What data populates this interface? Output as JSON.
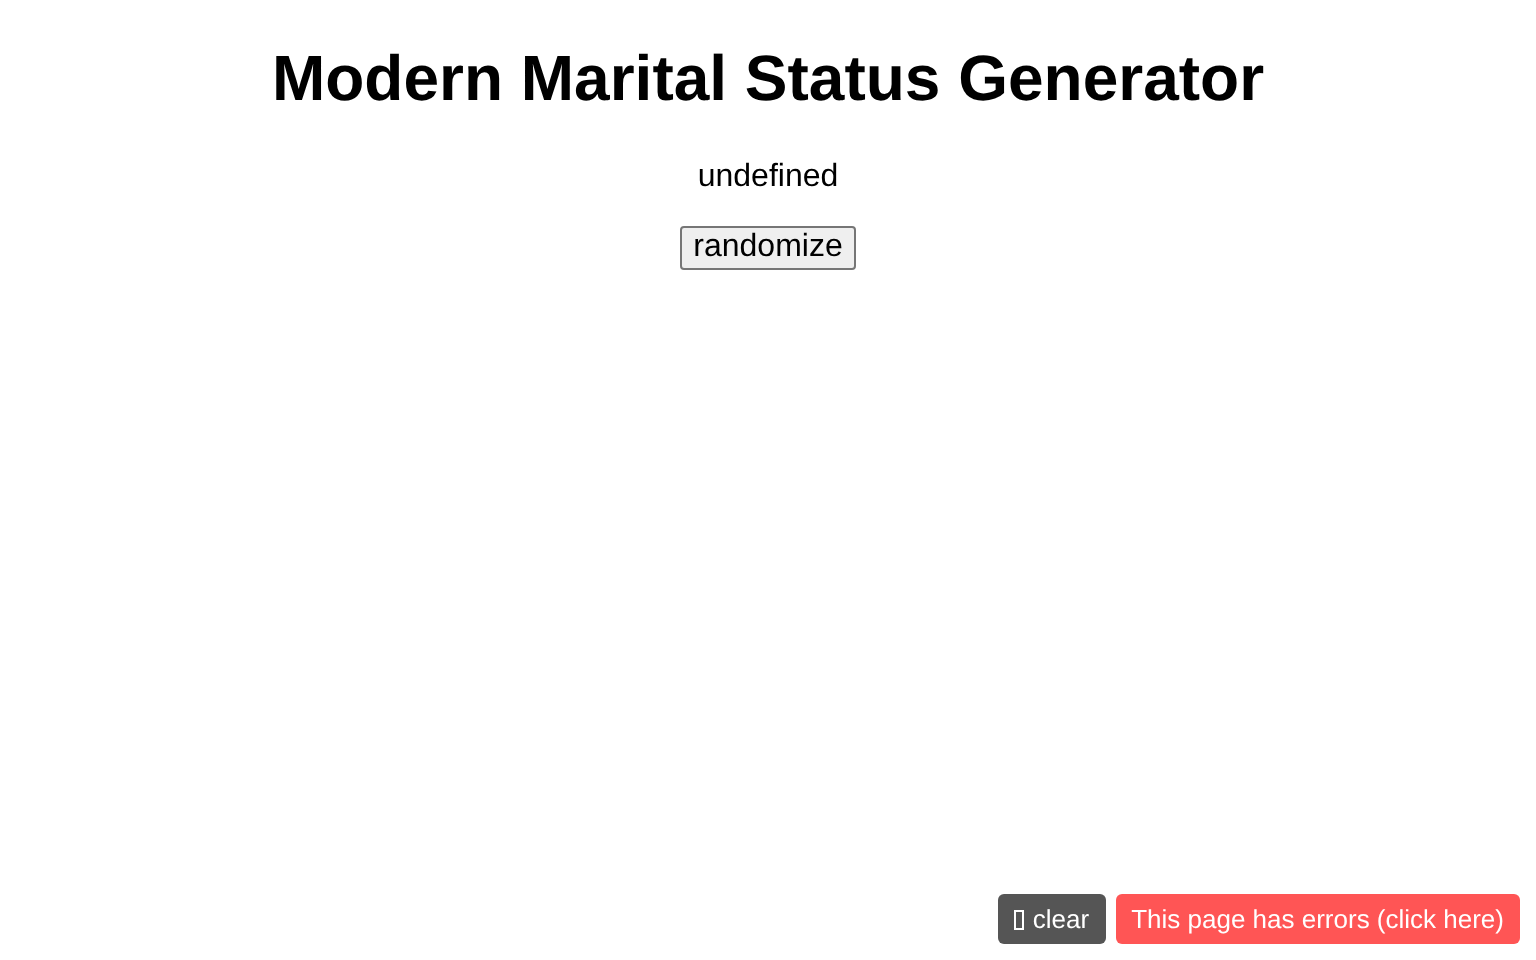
{
  "title": "Modern Marital Status Generator",
  "result": "undefined",
  "randomize_button": "randomize",
  "clear_button": "clear",
  "error_button": "This page has errors (click here)"
}
